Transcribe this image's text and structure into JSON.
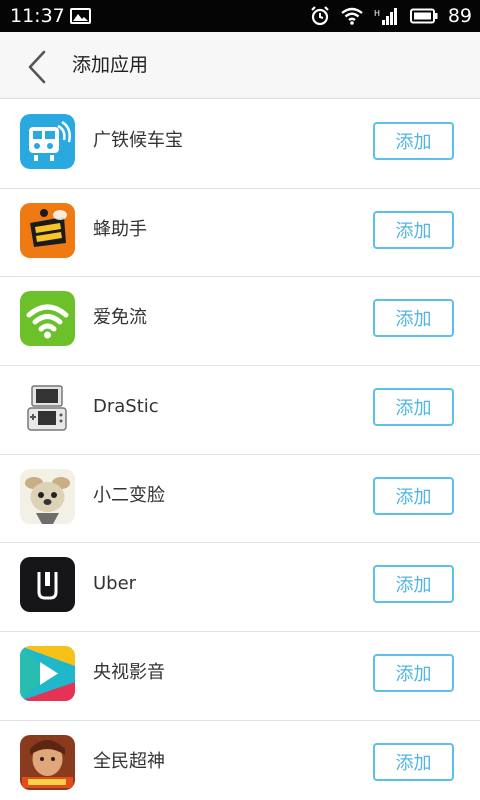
{
  "status_bar": {
    "time": "11:37",
    "battery": "89"
  },
  "header": {
    "title": "添加应用"
  },
  "apps": [
    {
      "name": "广铁候车宝",
      "button": "添加",
      "icon": "guangtie-icon"
    },
    {
      "name": "蜂助手",
      "button": "添加",
      "icon": "bee-icon"
    },
    {
      "name": "爱免流",
      "button": "添加",
      "icon": "wifi-icon"
    },
    {
      "name": "DraStic",
      "button": "添加",
      "icon": "ds-console-icon"
    },
    {
      "name": "小二变脸",
      "button": "添加",
      "icon": "puppy-icon"
    },
    {
      "name": "Uber",
      "button": "添加",
      "icon": "uber-icon"
    },
    {
      "name": "央视影音",
      "button": "添加",
      "icon": "cctv-play-icon"
    },
    {
      "name": "全民超神",
      "button": "添加",
      "icon": "hero-game-icon"
    }
  ],
  "colors": {
    "accent": "#4fb6e3",
    "status_bar": "#050505",
    "header_bg": "#f7f7f7"
  }
}
